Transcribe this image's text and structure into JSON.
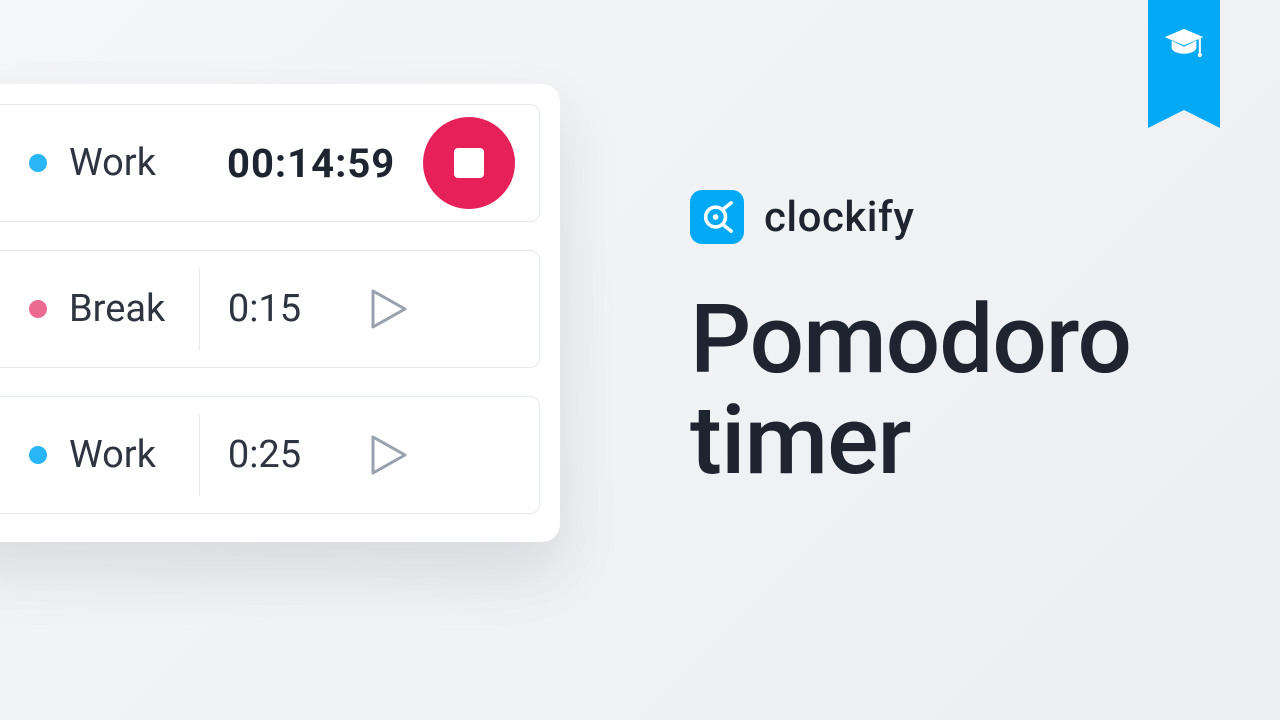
{
  "ribbon": {
    "icon": "graduation-cap-icon"
  },
  "brand": {
    "name": "clockify"
  },
  "title": "Pomodoro\ntimer",
  "colors": {
    "accent": "#03a9f4",
    "stop": "#e6215a",
    "work_dot": "#29b6f6",
    "break_dot": "#ec6a8f"
  },
  "timer_panel": {
    "active": {
      "label": "Work",
      "dot_color": "work_dot",
      "elapsed": "00:14:59",
      "action_icon": "stop-icon"
    },
    "queue": [
      {
        "label": "Break",
        "dot_color": "break_dot",
        "duration": "0:15",
        "action_icon": "play-icon"
      },
      {
        "label": "Work",
        "dot_color": "work_dot",
        "duration": "0:25",
        "action_icon": "play-icon"
      }
    ]
  }
}
